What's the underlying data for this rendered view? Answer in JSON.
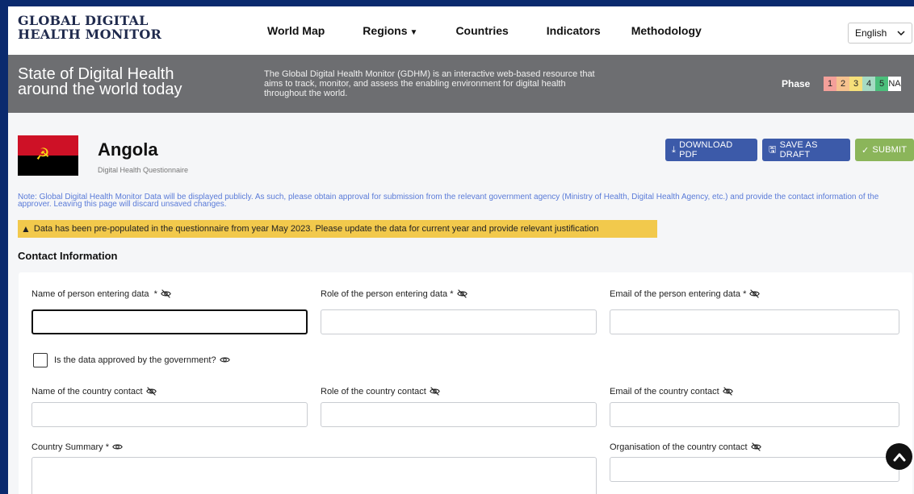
{
  "header": {
    "logo_line1": "GLOBAL DIGITAL",
    "logo_line2": "HEALTH MONITOR",
    "nav": [
      "World Map",
      "Regions",
      "Countries",
      "Indicators",
      "Methodology"
    ],
    "language": "English"
  },
  "banner": {
    "title_line1": "State of Digital Health",
    "title_line2": "around the world today",
    "description": "The Global Digital Health Monitor (GDHM) is an interactive web-based resource that aims to track, monitor, and assess the enabling environment for digital health throughout the world.",
    "phase_label": "Phase",
    "phases": [
      {
        "label": "1",
        "color": "#f4a09a"
      },
      {
        "label": "2",
        "color": "#f6c28f"
      },
      {
        "label": "3",
        "color": "#f6e07a"
      },
      {
        "label": "4",
        "color": "#a6dbc4"
      },
      {
        "label": "5",
        "color": "#4bbf7b"
      },
      {
        "label": "NA",
        "color": "#ffffff"
      }
    ]
  },
  "country": {
    "name": "Angola",
    "subtitle": "Digital Health Questionnaire",
    "flag_colors": {
      "top": "#ce1126",
      "bottom": "#000000",
      "emblem": "#f9d616"
    }
  },
  "actions": {
    "download": "DOWNLOAD PDF",
    "draft": "SAVE AS DRAFT",
    "submit": "SUBMIT"
  },
  "note": "Note: Global Digital Health Monitor Data will be displayed publicly. As such, please obtain approval for submission from the relevant government agency (Ministry of Health, Digital Health Agency, etc.) and provide the contact information of the approver. Leaving this page will discard unsaved changes.",
  "warning": "Data has been pre-populated in the questionnaire from year May 2023. Please update the data for current year and provide relevant justification",
  "section": "Contact Information",
  "form": {
    "name_label": "Name of person entering data",
    "role_label": "Role of the person entering data",
    "email_label": "Email of the person entering data",
    "approved_label": "Is the data approved by the government?",
    "country_contact_name": "Name of the country contact",
    "country_contact_role": "Role of the country contact",
    "country_contact_email": "Email of the country contact",
    "summary_label": "Country Summary",
    "org_label": "Organisation of the country contact"
  },
  "icons": {
    "eye_hidden": "eye-slash-icon",
    "eye": "eye-icon",
    "scroll_top": "chevron-up-icon"
  }
}
